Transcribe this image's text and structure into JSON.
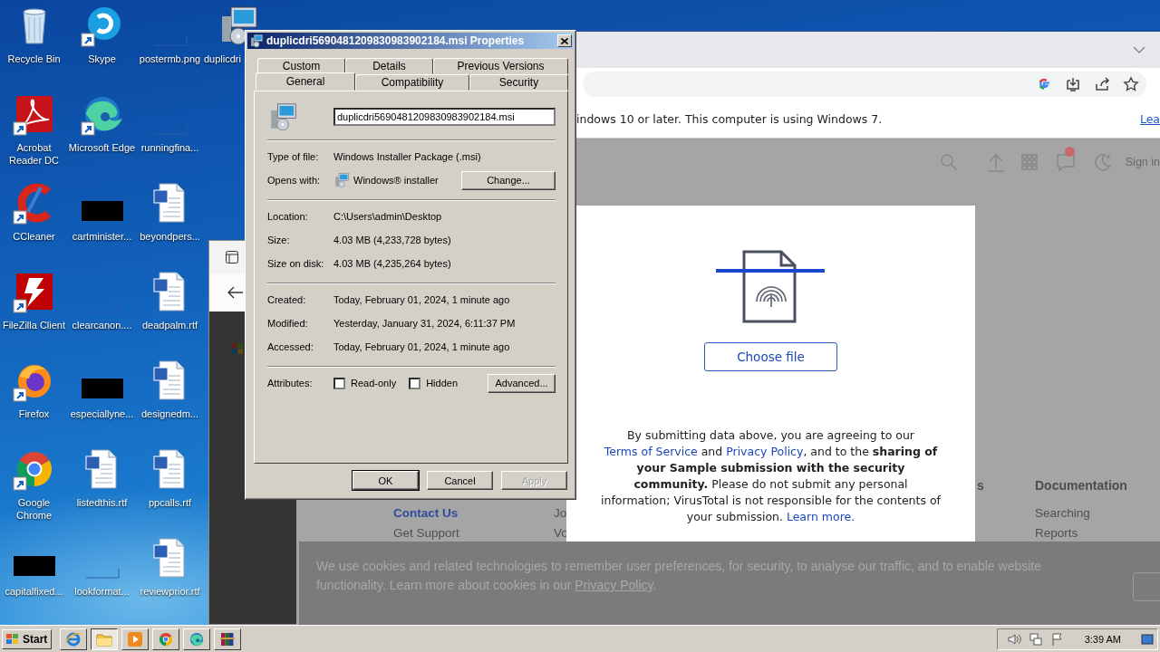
{
  "desktop": {
    "icons": [
      {
        "label": "Recycle Bin",
        "kind": "recycle",
        "shortcut": false
      },
      {
        "label": "Acrobat Reader DC",
        "kind": "acrobat",
        "shortcut": true
      },
      {
        "label": "CCleaner",
        "kind": "ccleaner",
        "shortcut": true
      },
      {
        "label": "FileZilla Client",
        "kind": "filezilla",
        "shortcut": true
      },
      {
        "label": "Firefox",
        "kind": "firefox",
        "shortcut": true
      },
      {
        "label": "Google Chrome",
        "kind": "chrome",
        "shortcut": true
      },
      {
        "label": "capitalfixed...",
        "kind": "black",
        "shortcut": false
      },
      {
        "label": "Skype",
        "kind": "skype",
        "shortcut": true
      },
      {
        "label": "Microsoft Edge",
        "kind": "edge",
        "shortcut": true
      },
      {
        "label": "cartminister...",
        "kind": "black",
        "shortcut": false
      },
      {
        "label": "clearcanon....",
        "kind": "blank",
        "shortcut": false
      },
      {
        "label": "especiallyne...",
        "kind": "black",
        "shortcut": false
      },
      {
        "label": "listedthis.rtf",
        "kind": "word",
        "shortcut": false
      },
      {
        "label": "lookformat...",
        "kind": "blank",
        "shortcut": false
      },
      {
        "label": "postermb.png",
        "kind": "blank",
        "shortcut": false
      },
      {
        "label": "runningfina...",
        "kind": "blank",
        "shortcut": false
      },
      {
        "label": "beyondpers...",
        "kind": "word",
        "shortcut": false
      },
      {
        "label": "deadpalm.rtf",
        "kind": "word",
        "shortcut": false
      },
      {
        "label": "designedm...",
        "kind": "word",
        "shortcut": false
      },
      {
        "label": "ppcalls.rtf",
        "kind": "word",
        "shortcut": false
      },
      {
        "label": "reviewprior.rtf",
        "kind": "word",
        "shortcut": false
      },
      {
        "label": "duplicdri",
        "kind": "installer",
        "shortcut": false
      }
    ]
  },
  "browser": {
    "infobar": {
      "text": "indows 10 or later. This computer is using Windows 7.",
      "link": "Lea"
    },
    "header": {
      "sign_in": "Sign in",
      "notification_badge": true
    },
    "footer": [
      {
        "links": [
          {
            "text": "Contact Us",
            "highlighted": true
          },
          {
            "text": "Get Support",
            "highlighted": false
          }
        ]
      },
      {
        "links": [
          {
            "text": "Jo",
            "highlighted": false
          },
          {
            "text": "Vo",
            "highlighted": false
          }
        ]
      },
      {
        "heading": "s"
      },
      {
        "heading": "Documentation",
        "links": [
          {
            "text": "Searching",
            "highlighted": false
          },
          {
            "text": "Reports",
            "highlighted": false
          }
        ]
      }
    ],
    "cookie_banner": {
      "text": "We use cookies and related technologies to remember user preferences, for security, to analyse our traffic, and to enable website functionality. Learn more about cookies in our ",
      "link": "Privacy Policy",
      "after": "."
    },
    "modal": {
      "button": "Choose file",
      "terms": [
        {
          "kind": "text",
          "text": "By submitting data above, you are agreeing to our "
        },
        {
          "kind": "link",
          "text": "Terms of Service"
        },
        {
          "kind": "text",
          "text": " and "
        },
        {
          "kind": "link",
          "text": "Privacy Policy"
        },
        {
          "kind": "text",
          "text": ", and to the "
        },
        {
          "kind": "bold",
          "text": "sharing of your Sample submission with the security community."
        },
        {
          "kind": "text",
          "text": " Please do not submit any personal information; VirusTotal is not responsible for the contents of your submission. "
        },
        {
          "kind": "link",
          "text": "Learn more."
        }
      ]
    }
  },
  "dialog": {
    "title": "duplicdri5690481209830983902184.msi Properties",
    "tab_rows": [
      [
        {
          "label": "Custom",
          "selected": false
        },
        {
          "label": "Details",
          "selected": false
        },
        {
          "label": "Previous Versions",
          "selected": false
        }
      ],
      [
        {
          "label": "General",
          "selected": true
        },
        {
          "label": "Compatibility",
          "selected": false
        },
        {
          "label": "Security",
          "selected": false
        }
      ]
    ],
    "file_name": "duplicdri5690481209830983902184.msi",
    "groups": [
      [
        {
          "label": "Type of file:",
          "value": "Windows Installer Package (.msi)"
        },
        {
          "label": "Opens with:",
          "value": "Windows® installer",
          "button": "Change..."
        }
      ],
      [
        {
          "label": "Location:",
          "value": "C:\\Users\\admin\\Desktop"
        },
        {
          "label": "Size:",
          "value": "4.03 MB (4,233,728 bytes)"
        },
        {
          "label": "Size on disk:",
          "value": "4.03 MB (4,235,264 bytes)"
        }
      ],
      [
        {
          "label": "Created:",
          "value": "Today, February 01, 2024, 1 minute ago"
        },
        {
          "label": "Modified:",
          "value": "Yesterday, January 31, 2024, 6:11:37 PM"
        },
        {
          "label": "Accessed:",
          "value": "Today, February 01, 2024, 1 minute ago"
        }
      ]
    ],
    "attributes": {
      "label": "Attributes:",
      "checkboxes": [
        {
          "label": "Read-only",
          "checked": false
        },
        {
          "label": "Hidden",
          "checked": false
        }
      ],
      "button": "Advanced..."
    },
    "buttons": [
      {
        "label": "OK",
        "disabled": false,
        "default": true
      },
      {
        "label": "Cancel",
        "disabled": false,
        "default": false
      },
      {
        "label": "Apply",
        "disabled": true,
        "default": false
      }
    ]
  },
  "taskbar": {
    "start": "Start",
    "apps": [
      {
        "kind": "ie",
        "active": false
      },
      {
        "kind": "explorer",
        "active": true
      },
      {
        "kind": "media",
        "active": false
      },
      {
        "kind": "chrome",
        "active": false
      },
      {
        "kind": "edge",
        "active": false
      },
      {
        "kind": "winrar",
        "active": false
      }
    ],
    "clock": "3:39 AM"
  }
}
